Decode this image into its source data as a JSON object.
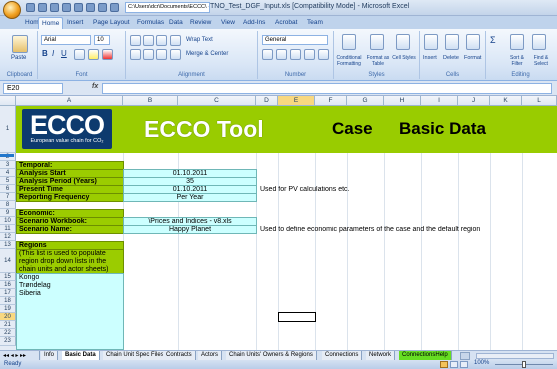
{
  "window": {
    "title": "TNO_Test_DGF_Input.xls [Compatibility Mode] - Microsoft Excel",
    "path": "C:\\Users\\dcr\\Documents\\ECCC\\ ·"
  },
  "ribbon": {
    "tabs": [
      "Home",
      "Insert",
      "Page Layout",
      "Formulas",
      "Data",
      "Review",
      "View",
      "Add-Ins",
      "Acrobat",
      "Team"
    ],
    "active_tab": "Home",
    "groups": {
      "clipboard": {
        "label": "Clipboard",
        "paste": "Paste"
      },
      "font": {
        "label": "Font",
        "family": "Arial",
        "size": "10"
      },
      "alignment": {
        "label": "Alignment",
        "wrap": "Wrap Text",
        "merge": "Merge & Center"
      },
      "number": {
        "label": "Number",
        "format": "General"
      },
      "styles": {
        "label": "Styles",
        "conditional": "Conditional Formatting",
        "format_table": "Format as Table",
        "cell_styles": "Cell Styles"
      },
      "cells": {
        "label": "Cells",
        "insert": "Insert",
        "delete": "Delete",
        "format": "Format"
      },
      "editing": {
        "label": "Editing",
        "sort": "Sort & Filter",
        "find": "Find & Select"
      }
    }
  },
  "formula_bar": {
    "name_box": "E20",
    "fx": "fx",
    "content": ""
  },
  "columns": [
    "A",
    "B",
    "C",
    "D",
    "E",
    "F",
    "G",
    "H",
    "I",
    "J",
    "K",
    "L"
  ],
  "selected_column": "E",
  "rows": [
    "1",
    "2",
    "3",
    "4",
    "5",
    "6",
    "7",
    "8",
    "9",
    "10",
    "11",
    "12",
    "13",
    "14",
    "15",
    "16",
    "17",
    "18",
    "19",
    "20",
    "21",
    "22",
    "23"
  ],
  "selected_row": "20",
  "banner": {
    "logo_word": "ECCO",
    "logo_sub": "European value chain for CO₂",
    "title": "ECCO Tool",
    "case": "Case",
    "subtitle": "Basic Data"
  },
  "sheet": {
    "temporal_header": "Temporal:",
    "analysis_start_label": "Analysis Start",
    "analysis_start_value": "01.10.2011",
    "analysis_period_label": "Analysis Period (Years)",
    "analysis_period_value": "35",
    "present_time_label": "Present Time",
    "present_time_value": "01.10.2011",
    "present_time_note": "Used for PV calculations etc.",
    "reporting_frequency_label": "Reporting Frequency",
    "reporting_frequency_value": "Per Year",
    "economic_header": "Economic:",
    "scenario_workbook_label": "Scenario Workbook:",
    "scenario_workbook_value": "\\Prices and Indices - v8.xls",
    "scenario_name_label": "Scenario Name:",
    "scenario_name_value": "Happy Planet",
    "scenario_note": "Used to define economic parameters of the case and the default region",
    "regions_header": "Regions",
    "regions_note_1": "(This list is used to populate",
    "regions_note_2": "region drop down lists in the",
    "regions_note_3": "chain units and actor sheets)",
    "regions": [
      "Kongo",
      "Trøndelag",
      "Siberia"
    ]
  },
  "sheet_tabs": [
    "Info",
    "Basic Data",
    "Chain Unit Spec Files",
    "Contracts",
    "Actors",
    "Chain Units' Owners & Regions",
    "Connections",
    "Network",
    "ConnectionsHelp"
  ],
  "active_sheet": "Basic Data",
  "status": {
    "left": "Ready",
    "zoom": "100%"
  }
}
